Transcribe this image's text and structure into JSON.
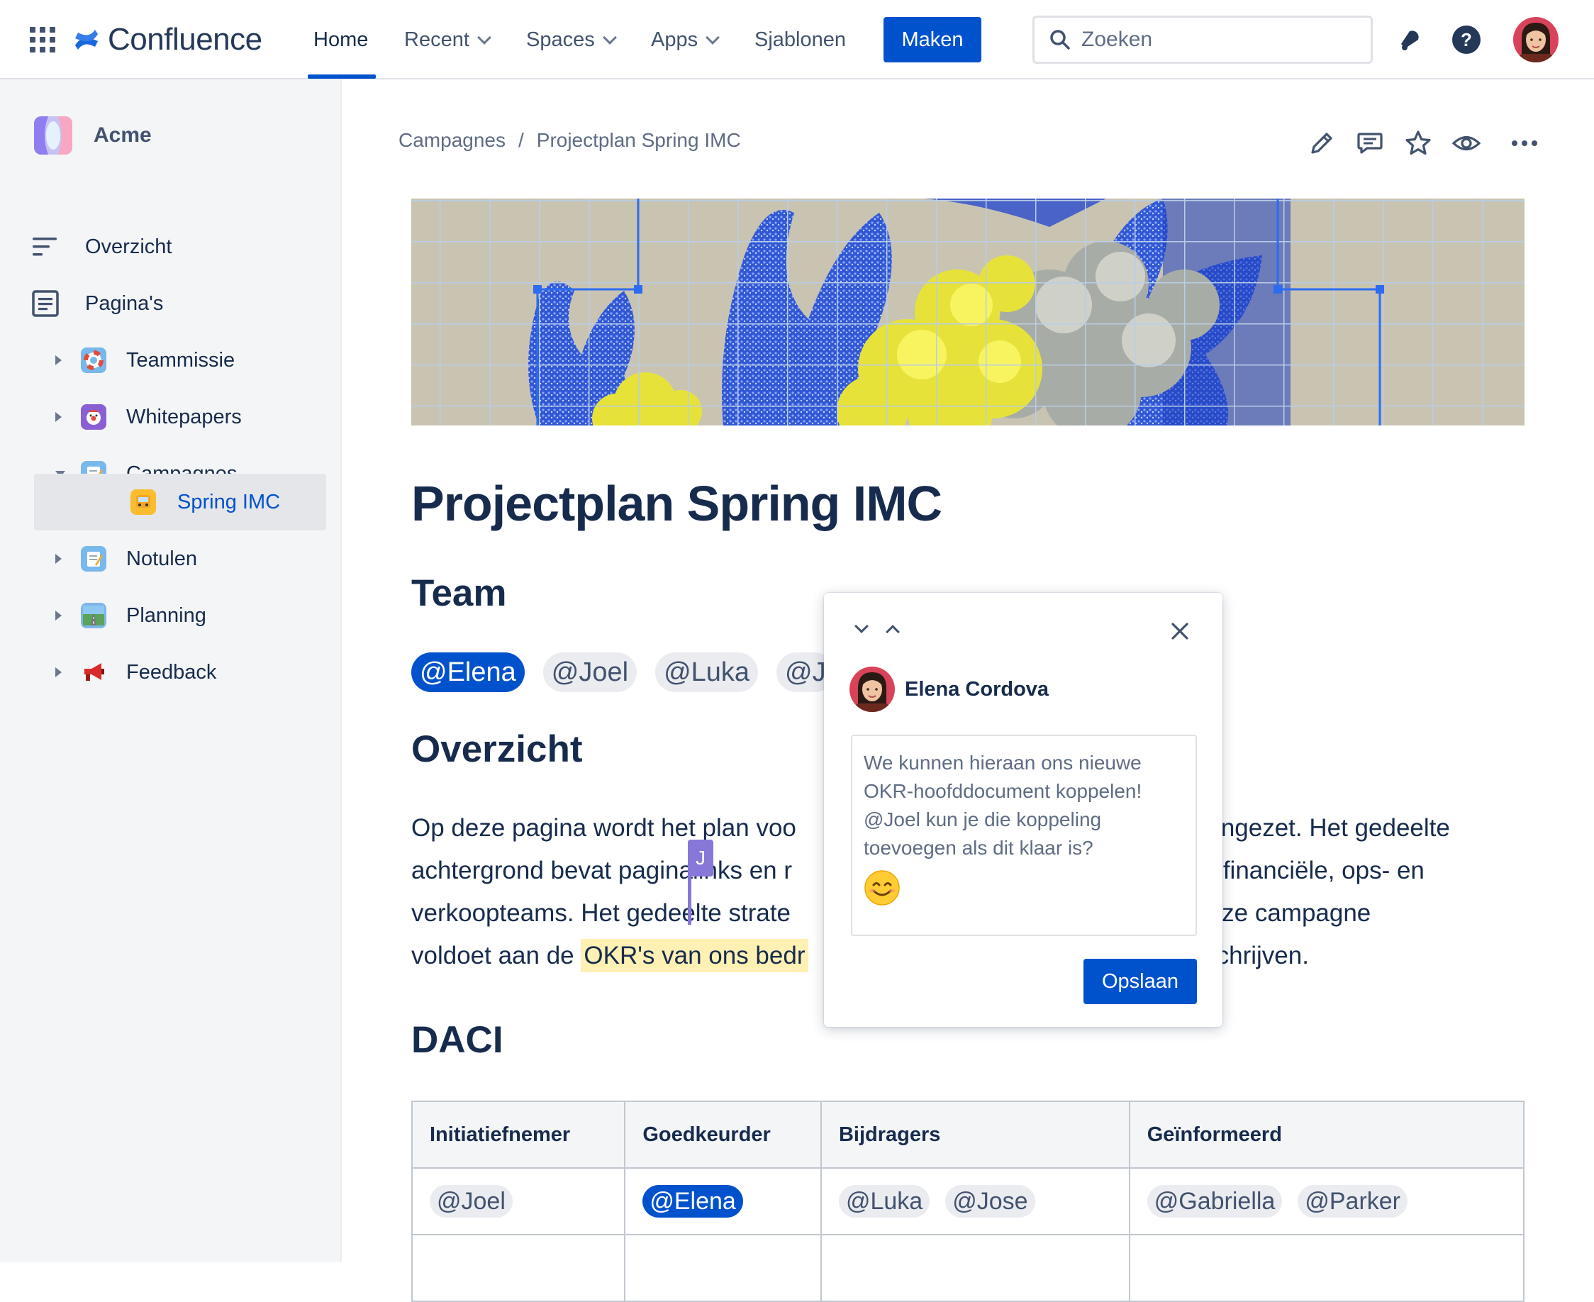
{
  "topnav": {
    "product": "Confluence",
    "items": [
      {
        "label": "Home"
      },
      {
        "label": "Recent"
      },
      {
        "label": "Spaces"
      },
      {
        "label": "Apps"
      },
      {
        "label": "Sjablonen"
      }
    ],
    "create_label": "Maken",
    "search_placeholder": "Zoeken",
    "active_item": "Home",
    "accent_color": "#0052cc"
  },
  "sidebar": {
    "space_name": "Acme",
    "items": [
      {
        "label": "Overzicht",
        "icon": "overview-icon"
      },
      {
        "label": "Pagina's",
        "icon": "pages-icon"
      }
    ],
    "tree": [
      {
        "label": "Teammissie",
        "icon": "lifebuoy-emoji",
        "expanded": false
      },
      {
        "label": "Whitepapers",
        "icon": "clown-emoji",
        "expanded": false
      },
      {
        "label": "Campagnes",
        "icon": "memo-emoji",
        "expanded": true
      },
      {
        "label": "Spring IMC",
        "icon": "bus-emoji",
        "selected": true
      },
      {
        "label": "Notulen",
        "icon": "memo-emoji",
        "expanded": false
      },
      {
        "label": "Planning",
        "icon": "road-emoji",
        "expanded": false
      },
      {
        "label": "Feedback",
        "icon": "megaphone-emoji",
        "expanded": false
      }
    ]
  },
  "breadcrumb": {
    "parent": "Campagnes",
    "separator": "/",
    "current": "Projectplan Spring IMC"
  },
  "page": {
    "title": "Projectplan Spring IMC",
    "team_heading": "Team",
    "team_mentions": [
      "@Elena",
      "@Joel",
      "@Luka",
      "@J"
    ],
    "overview_heading": "Overzicht",
    "overview_lines": [
      {
        "a": "Op deze pagina wordt het plan voo",
        "b": "eengezet. Het gedeelte"
      },
      {
        "a": "achtergrond bevat paginalinks en r",
        "b": "ing-, financiële, ops- en"
      },
      {
        "a": "verkoopteams. Het gedeelte strate",
        "b": "e deze campagne"
      },
      {
        "a": "voldoet aan de ",
        "hl": "OKR's van ons bedr",
        "b": "omschrijven."
      }
    ],
    "daci_heading": "DACI",
    "daci": {
      "headers": [
        "Initiatiefnemer",
        "Goedkeurder",
        "Bijdragers",
        "Geïnformeerd"
      ],
      "row": [
        [
          "@Joel"
        ],
        [
          "@Elena"
        ],
        [
          "@Luka",
          "@Jose"
        ],
        [
          "@Gabriella",
          "@Parker"
        ]
      ]
    }
  },
  "collab_cursor": {
    "initial": "J",
    "color": "#8777d9"
  },
  "comment": {
    "author": "Elena Cordova",
    "text": "We kunnen hieraan ons nieuwe OKR-hoofddocument koppelen! @Joel kun je die koppeling toevoegen als dit klaar is?",
    "emoji": "😊",
    "save_label": "Opslaan"
  }
}
